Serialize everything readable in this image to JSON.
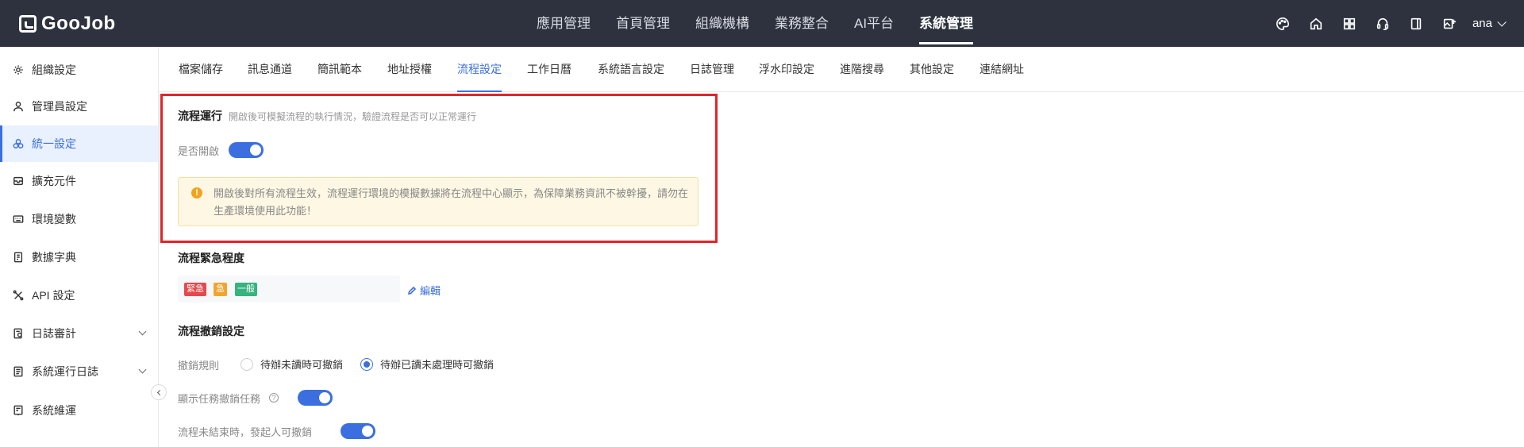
{
  "brand": {
    "name": "GooJob"
  },
  "top_nav": {
    "items": [
      "應用管理",
      "首頁管理",
      "組織機構",
      "業務整合",
      "AI平台",
      "系統管理"
    ],
    "active": "系統管理"
  },
  "top_icons": [
    "palette-icon",
    "home-icon",
    "apps-grid-icon",
    "headset-icon",
    "book-icon",
    "image-add-icon"
  ],
  "user": {
    "name": "ana"
  },
  "sidebar": {
    "items": [
      {
        "label": "組織設定",
        "icon": "gear-icon"
      },
      {
        "label": "管理員設定",
        "icon": "user-icon"
      },
      {
        "label": "統一設定",
        "icon": "settings-cluster-icon",
        "active": true
      },
      {
        "label": "擴充元件",
        "icon": "box-icon"
      },
      {
        "label": "環境變數",
        "icon": "keyboard-icon"
      },
      {
        "label": "數據字典",
        "icon": "dictionary-icon"
      },
      {
        "label": "API 設定",
        "icon": "api-icon"
      },
      {
        "label": "日誌審計",
        "icon": "audit-icon",
        "expandable": true
      },
      {
        "label": "系統運行日誌",
        "icon": "log-icon",
        "expandable": true
      },
      {
        "label": "系統維運",
        "icon": "maintenance-icon"
      }
    ]
  },
  "sub_tabs": {
    "items": [
      "檔案儲存",
      "訊息通道",
      "簡訊範本",
      "地址授權",
      "流程設定",
      "工作日曆",
      "系統語言設定",
      "日誌管理",
      "浮水印設定",
      "進階搜尋",
      "其他設定",
      "連結網址"
    ],
    "active": "流程設定"
  },
  "process_run": {
    "title": "流程運行",
    "description": "開啟後可模擬流程的執行情況，驗證流程是否可以正常運行",
    "enable_label": "是否開啟",
    "enabled": true,
    "warning": "開啟後對所有流程生效，流程運行環境的模擬數據將在流程中心顯示，為保障業務資訊不被幹擾，請勿在生產環境使用此功能！"
  },
  "urgency": {
    "title": "流程緊急程度",
    "tags": [
      {
        "label": "緊急",
        "color": "#e5484d"
      },
      {
        "label": "急",
        "color": "#f0a530"
      },
      {
        "label": "一般",
        "color": "#36b37e"
      }
    ],
    "edit_label": "編輯"
  },
  "revoke": {
    "title": "流程撤銷設定",
    "rule_label": "撤銷規則",
    "options": [
      "待辦未讀時可撤銷",
      "待辦已讀未處理時可撤銷"
    ],
    "selected": "待辦已讀未處理時可撤銷",
    "show_task_label": "顯示任務撤銷任務",
    "show_task_enabled": true,
    "initiator_label": "流程未結束時，發起人可撤銷",
    "initiator_enabled": true
  },
  "colors": {
    "accent": "#3b6fe0",
    "header_bg": "#2d323e",
    "highlight_border": "#e0262b",
    "warning_bg": "#fdf7e3"
  }
}
